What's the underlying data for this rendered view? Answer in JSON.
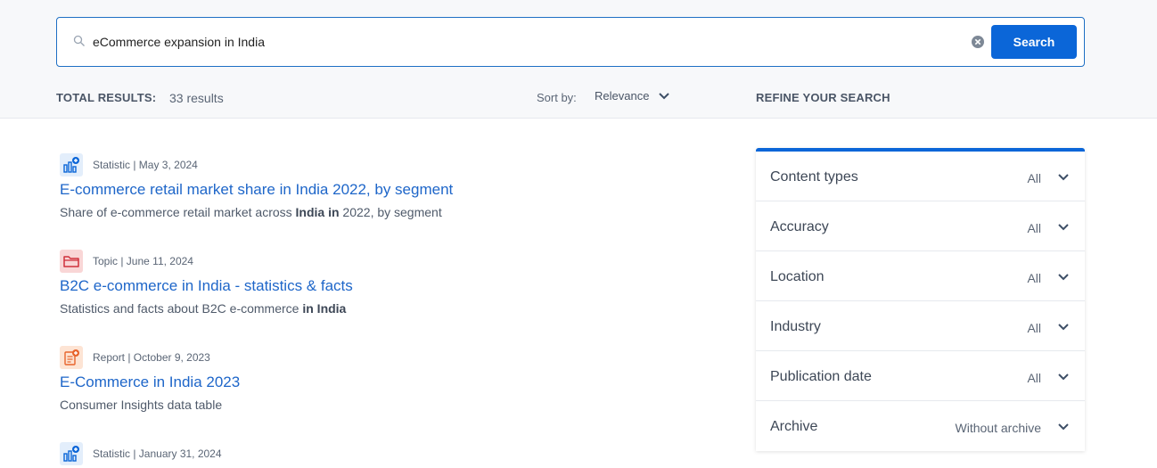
{
  "search": {
    "query": "eCommerce expansion in India",
    "button_label": "Search"
  },
  "summary": {
    "total_label": "TOTAL RESULTS:",
    "total_value": "33 results",
    "sort_label": "Sort by:",
    "sort_value": "Relevance",
    "refine_title": "REFINE YOUR SEARCH"
  },
  "results": [
    {
      "icon": "statistic-icon",
      "meta": "Statistic | May 3, 2024",
      "title": "E-commerce retail market share in India 2022, by segment",
      "desc_before": "Share of e-commerce retail market across ",
      "desc_bold": "India in",
      "desc_after": " 2022, by segment"
    },
    {
      "icon": "topic-icon",
      "meta": "Topic | June 11, 2024",
      "title": "B2C e-commerce in India - statistics & facts",
      "desc_before": "Statistics and facts about B2C e-commerce ",
      "desc_bold": "in India",
      "desc_after": ""
    },
    {
      "icon": "report-icon",
      "meta": "Report | October 9, 2023",
      "title": "E-Commerce in India 2023",
      "desc_before": "Consumer Insights data table",
      "desc_bold": "",
      "desc_after": ""
    },
    {
      "icon": "statistic-icon",
      "meta": "Statistic | January 31, 2024"
    }
  ],
  "filters": [
    {
      "name": "Content types",
      "value": "All"
    },
    {
      "name": "Accuracy",
      "value": "All"
    },
    {
      "name": "Location",
      "value": "All"
    },
    {
      "name": "Industry",
      "value": "All"
    },
    {
      "name": "Publication date",
      "value": "All"
    },
    {
      "name": "Archive",
      "value": "Without archive"
    }
  ],
  "colors": {
    "accent": "#0b66d8",
    "link": "#1e66c9",
    "statistic_icon_bg": "#e3eefb",
    "topic_icon_bg": "#f9d6d6",
    "report_icon_bg": "#fde4d4"
  }
}
